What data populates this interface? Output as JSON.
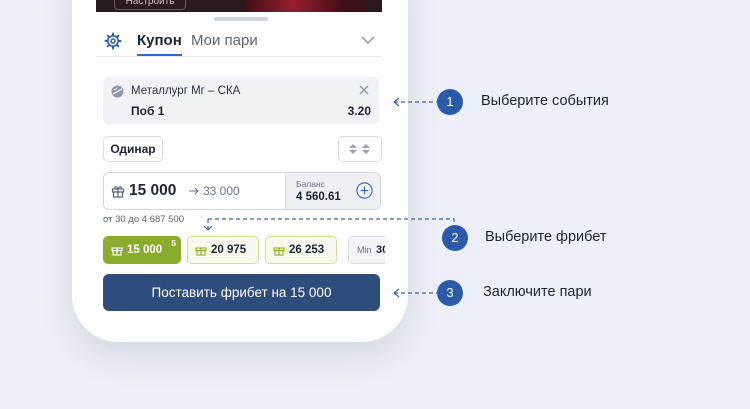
{
  "colors": {
    "accent": "#2f68c9",
    "primary_button": "#2e4d7c",
    "badge": "#2b5ba8",
    "freebet_selected": "#8aac2c",
    "background": "#edf0f6"
  },
  "header_partial": {
    "cover_button_label": "Настроить"
  },
  "coupon": {
    "tabs": [
      {
        "label": "Купон",
        "active": true
      },
      {
        "label": "Мои пари",
        "active": false
      }
    ],
    "event": {
      "icon": "ball-icon",
      "name": "Металлург Мг – СКА",
      "outcome": "Поб 1",
      "odds": "3.20"
    },
    "bet_type": "Одинар",
    "stake": {
      "amount": "15 000",
      "payout": "33 000",
      "balance_label": "Баланс",
      "balance_value": "4 560.61"
    },
    "range_hint": "от 30 до 4 687 500",
    "freebets": [
      {
        "value": "15 000",
        "count": "5",
        "selected": true
      },
      {
        "value": "20 975",
        "selected": false
      },
      {
        "value": "26 253",
        "selected": false
      }
    ],
    "min_chip": {
      "label": "Min",
      "value": "30"
    },
    "place_button": "Поставить фрибет на 15 000"
  },
  "steps": [
    {
      "number": "1",
      "label": "Выберите события"
    },
    {
      "number": "2",
      "label": "Выберите фрибет"
    },
    {
      "number": "3",
      "label": "Заключите пари"
    }
  ]
}
